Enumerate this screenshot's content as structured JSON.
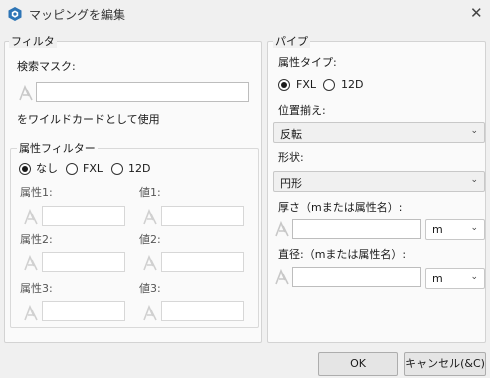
{
  "window": {
    "title": "マッピングを編集",
    "close": "✕"
  },
  "filter": {
    "legend": "フィルタ",
    "search_label": "検索マスク:",
    "search_value": "",
    "wildcard_note": "をワイルドカードとして使用",
    "attr_filter": {
      "legend": "属性フィルター",
      "options": [
        "なし",
        "FXL",
        "12D"
      ],
      "selected": "なし",
      "attr1": "属性1:",
      "attr2": "属性2:",
      "attr3": "属性3:",
      "val1": "値1:",
      "val2": "値2:",
      "val3": "値3:"
    }
  },
  "pipe": {
    "legend": "パイプ",
    "attr_type_label": "属性タイプ:",
    "attr_type_options": [
      "FXL",
      "12D"
    ],
    "attr_type_selected": "FXL",
    "align_label": "位置揃え:",
    "align_value": "反転",
    "shape_label": "形状:",
    "shape_value": "円形",
    "thickness_label": "厚さ（mまたは属性名）:",
    "thickness_value": "",
    "thickness_unit": "m",
    "diameter_label": "直径:（mまたは属性名）:",
    "diameter_value": "",
    "diameter_unit": "m"
  },
  "buttons": {
    "ok": "OK",
    "cancel": "キャンセル(&C)"
  },
  "icons": {
    "app": "app-logo-icon",
    "wildcard": "wildcard-icon",
    "dropdown": "chevron-down-icon"
  }
}
